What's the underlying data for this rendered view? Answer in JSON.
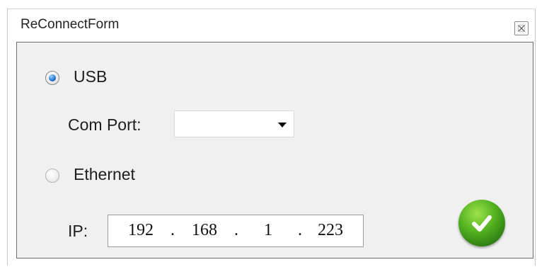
{
  "window": {
    "title": "ReConnectForm",
    "close_icon": "close-icon"
  },
  "usb": {
    "label": "USB",
    "selected": true,
    "com_port_label": "Com Port:",
    "com_port_value": ""
  },
  "ethernet": {
    "label": "Ethernet",
    "selected": false,
    "ip_label": "IP:",
    "ip": {
      "octet1": "192",
      "octet2": "168",
      "octet3": "1",
      "octet4": "223",
      "separator": "."
    }
  },
  "ok_button": {
    "icon": "checkmark-icon",
    "color": "#4fae1e"
  },
  "colors": {
    "radio_accent": "#2b7bd6",
    "panel_background": "#f0f0f0"
  }
}
